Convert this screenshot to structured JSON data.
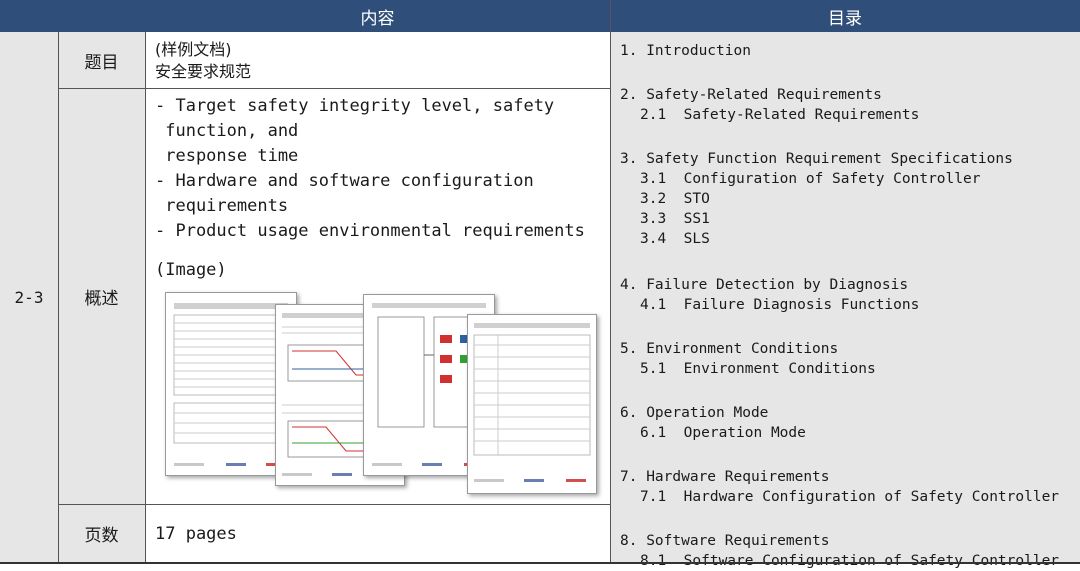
{
  "header": {
    "content_title": "内容",
    "toc_title": "目录"
  },
  "row_id": "2-3",
  "labels": {
    "title": "题目",
    "summary": "概述",
    "pages": "页数"
  },
  "title_cell": {
    "line1": "(样例文档)",
    "line2": "安全要求规范"
  },
  "summary_cell": {
    "lines": [
      "- Target safety integrity level, safety",
      " function, and",
      " response time",
      "- Hardware and software configuration",
      " requirements",
      "- Product usage environmental requirements"
    ],
    "image_label": "(Image)"
  },
  "pages_cell": {
    "value": "17 pages"
  },
  "toc": [
    {
      "heading": "1. Introduction",
      "items": []
    },
    {
      "heading": "2. Safety-Related Requirements",
      "items": [
        "2.1  Safety-Related Requirements"
      ]
    },
    {
      "heading": "3. Safety Function Requirement Specifications",
      "items": [
        "3.1  Configuration of Safety Controller",
        "3.2  STO",
        "3.3  SS1",
        "3.4  SLS"
      ]
    },
    {
      "heading": "4. Failure Detection by Diagnosis",
      "items": [
        "4.1  Failure Diagnosis Functions"
      ]
    },
    {
      "heading": "5. Environment Conditions",
      "items": [
        "5.1  Environment Conditions"
      ]
    },
    {
      "heading": "6. Operation Mode",
      "items": [
        "6.1  Operation Mode"
      ]
    },
    {
      "heading": "7. Hardware Requirements",
      "items": [
        "7.1  Hardware Configuration of Safety Controller"
      ]
    },
    {
      "heading": "8. Software Requirements",
      "items": [
        "8.1  Software Configuration of Safety Controller"
      ]
    }
  ]
}
